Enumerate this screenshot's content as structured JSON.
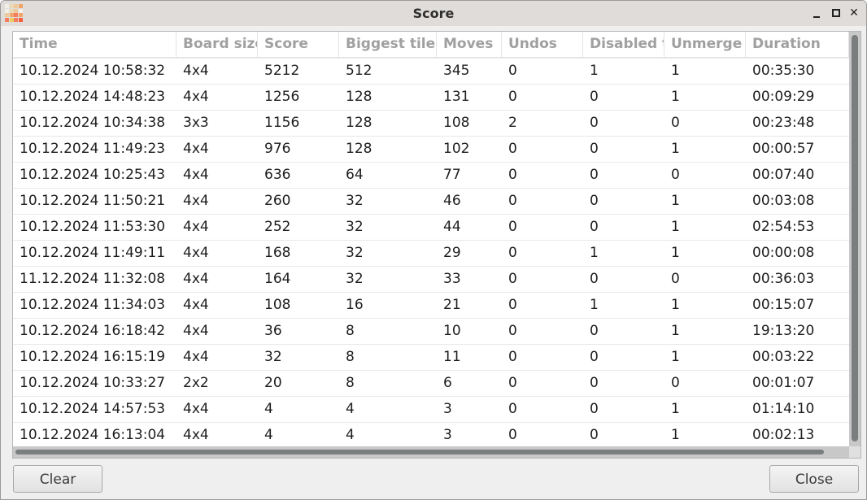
{
  "window": {
    "title": "Score",
    "controls": {
      "minimize": "minimize",
      "maximize": "maximize",
      "close": "close"
    }
  },
  "app_icon": {
    "name": "2048-grid-icon",
    "tiles": [
      "#f2efe9",
      "#ecd9b8",
      "#eec99a",
      "#f2a46a",
      "#f2efe9",
      "#ecd9b8",
      "#eec99a",
      "#f2efe9",
      "#eec99a",
      "#f2a46a",
      "#f47c5f",
      "#f2a46a",
      "#f47c5f",
      "#edcc61",
      "#f47c5f",
      "#f65e3b"
    ]
  },
  "table": {
    "columns": [
      "Time",
      "Board size",
      "Score",
      "Biggest tile",
      "Moves",
      "Undos",
      "Disabled tiles",
      "Unmerge",
      "Duration"
    ],
    "rows": [
      [
        "10.12.2024 10:58:32",
        "4x4",
        "5212",
        "512",
        "345",
        "0",
        "1",
        "1",
        "00:35:30"
      ],
      [
        "10.12.2024 14:48:23",
        "4x4",
        "1256",
        "128",
        "131",
        "0",
        "0",
        "1",
        "00:09:29"
      ],
      [
        "10.12.2024 10:34:38",
        "3x3",
        "1156",
        "128",
        "108",
        "2",
        "0",
        "0",
        "00:23:48"
      ],
      [
        "10.12.2024 11:49:23",
        "4x4",
        "976",
        "128",
        "102",
        "0",
        "0",
        "1",
        "00:00:57"
      ],
      [
        "10.12.2024 10:25:43",
        "4x4",
        "636",
        "64",
        "77",
        "0",
        "0",
        "0",
        "00:07:40"
      ],
      [
        "10.12.2024 11:50:21",
        "4x4",
        "260",
        "32",
        "46",
        "0",
        "0",
        "1",
        "00:03:08"
      ],
      [
        "10.12.2024 11:53:30",
        "4x4",
        "252",
        "32",
        "44",
        "0",
        "0",
        "1",
        "02:54:53"
      ],
      [
        "10.12.2024 11:49:11",
        "4x4",
        "168",
        "32",
        "29",
        "0",
        "1",
        "1",
        "00:00:08"
      ],
      [
        "11.12.2024 11:32:08",
        "4x4",
        "164",
        "32",
        "33",
        "0",
        "0",
        "0",
        "00:36:03"
      ],
      [
        "10.12.2024 11:34:03",
        "4x4",
        "108",
        "16",
        "21",
        "0",
        "1",
        "1",
        "00:15:07"
      ],
      [
        "10.12.2024 16:18:42",
        "4x4",
        "36",
        "8",
        "10",
        "0",
        "0",
        "1",
        "19:13:20"
      ],
      [
        "10.12.2024 16:15:19",
        "4x4",
        "32",
        "8",
        "11",
        "0",
        "0",
        "1",
        "00:03:22"
      ],
      [
        "10.12.2024 10:33:27",
        "2x2",
        "20",
        "8",
        "6",
        "0",
        "0",
        "0",
        "00:01:07"
      ],
      [
        "10.12.2024 14:57:53",
        "4x4",
        "4",
        "4",
        "3",
        "0",
        "0",
        "1",
        "01:14:10"
      ],
      [
        "10.12.2024 16:13:04",
        "4x4",
        "4",
        "4",
        "3",
        "0",
        "0",
        "1",
        "00:02:13"
      ]
    ]
  },
  "buttons": {
    "clear": "Clear",
    "close": "Close"
  }
}
